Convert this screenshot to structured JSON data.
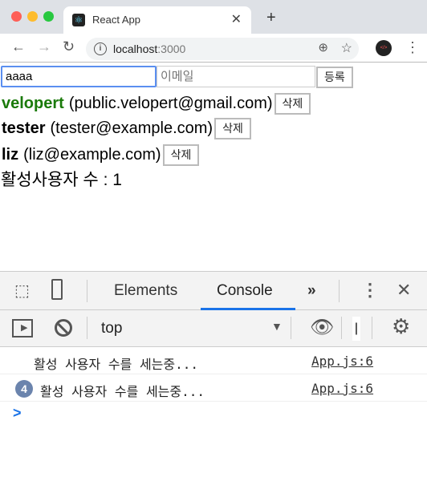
{
  "browser": {
    "tab_title": "React App",
    "url_host": "localhost",
    "url_port": ":3000"
  },
  "form": {
    "name_value": "aaaa",
    "email_placeholder": "이메일",
    "submit_label": "등록"
  },
  "users": [
    {
      "username": "velopert",
      "email": "(public.velopert@gmail.com)",
      "active": true,
      "delete_label": "삭제"
    },
    {
      "username": "tester",
      "email": "(tester@example.com)",
      "active": false,
      "delete_label": "삭제"
    },
    {
      "username": "liz",
      "email": "(liz@example.com)",
      "active": false,
      "delete_label": "삭제"
    }
  ],
  "active_count_text": "활성사용자 수 : 1",
  "colors": {
    "active_user": "#1a7a0a",
    "tab_underline": "#1a73e8"
  },
  "devtools": {
    "tabs": [
      "Elements",
      "Console"
    ],
    "active_tab": "Console",
    "more": "»",
    "context": "top",
    "logs": [
      {
        "count": null,
        "message": "활성 사용자 수를 세는중...",
        "source": "App.js:6"
      },
      {
        "count": "4",
        "message": "활성 사용자 수를 세는중...",
        "source": "App.js:6"
      }
    ],
    "prompt": ">"
  }
}
